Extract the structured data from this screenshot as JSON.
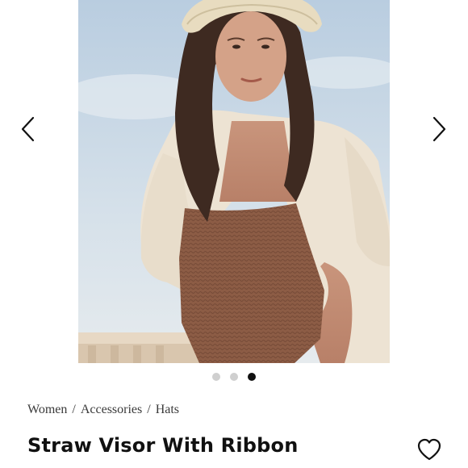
{
  "gallery": {
    "prev_icon": "chevron-left-icon",
    "next_icon": "chevron-right-icon",
    "slide_count": 3,
    "active_slide": 3
  },
  "breadcrumb": {
    "items": [
      "Women",
      "Accessories",
      "Hats"
    ],
    "separator": "/"
  },
  "product": {
    "title": "Straw Visor With Ribbon"
  },
  "wishlist": {
    "icon": "heart-outline-icon"
  },
  "colors": {
    "dot_active": "#111111",
    "dot_inactive": "#cfcfcf",
    "text": "#1a1a1a"
  }
}
